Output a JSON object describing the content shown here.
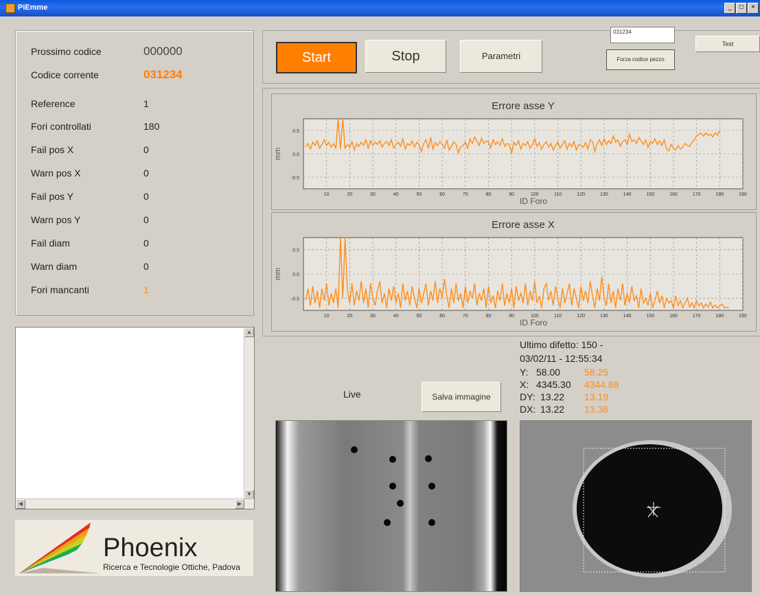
{
  "window": {
    "title": "PiEmme",
    "min": "_",
    "max": "□",
    "close": "×"
  },
  "stats": [
    {
      "label": "Prossimo codice",
      "value": "000000"
    },
    {
      "label": "Codice corrente",
      "value": "031234"
    },
    {
      "label": "Reference",
      "value": "1"
    },
    {
      "label": "Fori controllati",
      "value": "180"
    },
    {
      "label": "Fail pos X",
      "value": "0"
    },
    {
      "label": "Warn pos X",
      "value": "0"
    },
    {
      "label": "Fail pos Y",
      "value": "0"
    },
    {
      "label": "Warn pos Y",
      "value": "0"
    },
    {
      "label": "Fail diam",
      "value": "0"
    },
    {
      "label": "Warn diam",
      "value": "0"
    },
    {
      "label": "Fori mancanti",
      "value": "1"
    }
  ],
  "toolbar": {
    "start_label": "Start",
    "stop_label": "Stop",
    "param_label": "Parametri",
    "code_value": "031234",
    "forza_label": "Forza codice pezzo",
    "test_label": "Test"
  },
  "logo": {
    "name": "Phoenix",
    "subtitle": "Ricerca e Tecnologie Ottiche, Padova"
  },
  "live": {
    "label": "Live",
    "save_label": "Salva immagine"
  },
  "defect": {
    "line1": "Ultimo difetto:   150 -",
    "line2": "03/02/11 - 12:55:34",
    "rows": [
      {
        "key": "Y:",
        "measured": "58.00",
        "nominal": "58.25"
      },
      {
        "key": "X:",
        "measured": "4345.30",
        "nominal": "4344.68"
      },
      {
        "key": "DY:",
        "measured": "13.22",
        "nominal": "13.19"
      },
      {
        "key": "DX:",
        "measured": "13.22",
        "nominal": "13.36"
      }
    ]
  },
  "chart_data": [
    {
      "type": "line",
      "title": "Errore asse Y",
      "xlabel": "ID Foro",
      "ylabel": "mm",
      "xlim": [
        0,
        190
      ],
      "ylim": [
        -0.75,
        0.75
      ],
      "xticks": [
        10,
        20,
        30,
        40,
        50,
        60,
        70,
        80,
        90,
        100,
        110,
        120,
        130,
        140,
        150,
        160,
        170,
        180,
        190
      ],
      "yticks": [
        "0.5",
        "0.0",
        "-0.5"
      ],
      "grid": true,
      "color": "#ff8c1a",
      "series": [
        {
          "x_start": 1,
          "values": [
            0.15,
            0.22,
            0.1,
            0.25,
            0.18,
            0.28,
            0.12,
            0.2,
            0.3,
            0.18,
            0.25,
            0.14,
            0.22,
            0.12,
            0.75,
            0.1,
            0.75,
            0.12,
            0.2,
            0.14,
            0.26,
            0.08,
            0.22,
            0.16,
            0.25,
            0.18,
            0.3,
            0.12,
            0.28,
            0.18,
            0.25,
            0.2,
            0.28,
            0.14,
            0.22,
            0.26,
            0.18,
            0.3,
            0.12,
            0.2,
            0.25,
            0.16,
            0.32,
            0.1,
            0.22,
            0.18,
            0.28,
            0.14,
            0.25,
            0.2,
            0.05,
            0.22,
            0.3,
            0.12,
            0.35,
            0.1,
            0.24,
            0.18,
            0.26,
            0.2,
            0.12,
            0.3,
            0.08,
            0.16,
            0.26,
            0.2,
            0.02,
            0.15,
            0.18,
            0.25,
            0.12,
            0.32,
            0.22,
            0.36,
            0.28,
            0.18,
            0.33,
            0.22,
            0.28,
            0.25,
            0.12,
            0.3,
            0.2,
            0.26,
            0.18,
            0.32,
            0.16,
            0.22,
            0.2,
            0.0,
            0.25,
            0.18,
            0.28,
            0.1,
            0.22,
            0.18,
            0.26,
            0.12,
            0.2,
            0.32,
            0.16,
            0.24,
            0.1,
            0.2,
            0.26,
            0.14,
            0.22,
            0.08,
            0.18,
            0.25,
            0.12,
            0.2,
            0.28,
            0.1,
            0.22,
            0.15,
            0.26,
            0.08,
            0.2,
            0.18,
            0.14,
            0.24,
            0.1,
            0.3,
            0.26,
            0.05,
            0.22,
            0.3,
            0.18,
            0.32,
            0.2,
            0.28,
            0.22,
            0.38,
            0.25,
            0.3,
            0.16,
            0.26,
            0.3,
            0.2,
            0.42,
            0.26,
            0.3,
            0.22,
            0.35,
            0.28,
            0.2,
            0.3,
            0.14,
            0.26,
            0.22,
            0.32,
            0.2,
            0.28,
            0.18,
            0.3,
            0.1,
            0.06,
            0.2,
            0.12,
            0.08,
            0.18,
            0.1,
            0.14,
            0.22,
            0.18,
            0.16,
            0.25,
            0.3,
            0.38,
            0.42,
            0.44,
            0.38,
            0.45,
            0.4,
            0.42,
            0.36,
            0.45,
            0.4,
            0.5
          ]
        }
      ]
    },
    {
      "type": "line",
      "title": "Errore asse X",
      "xlabel": "ID Foro",
      "ylabel": "mm",
      "xlim": [
        0,
        190
      ],
      "ylim": [
        -0.75,
        0.75
      ],
      "xticks": [
        10,
        20,
        30,
        40,
        50,
        60,
        70,
        80,
        90,
        100,
        110,
        120,
        130,
        140,
        150,
        160,
        170,
        180,
        190
      ],
      "yticks": [
        "0.5",
        "0.0",
        "-0.5"
      ],
      "grid": true,
      "color": "#ff8c1a",
      "series": [
        {
          "x_start": 1,
          "values": [
            -0.55,
            -0.3,
            -0.65,
            -0.25,
            -0.6,
            -0.35,
            -0.7,
            -0.3,
            -0.55,
            -0.2,
            -0.65,
            -0.4,
            -0.6,
            -0.3,
            -0.7,
            0.75,
            -0.5,
            0.75,
            -0.35,
            -0.6,
            -0.2,
            -0.65,
            -0.35,
            -0.55,
            -0.15,
            -0.6,
            -0.3,
            -0.7,
            -0.2,
            -0.5,
            -0.65,
            -0.35,
            -0.15,
            -0.6,
            -0.4,
            -0.7,
            -0.3,
            -0.55,
            -0.25,
            -0.6,
            -0.4,
            -0.7,
            -0.2,
            -0.55,
            -0.35,
            -0.65,
            -0.25,
            -0.5,
            -0.7,
            -0.3,
            -0.6,
            -0.4,
            -0.2,
            -0.65,
            -0.35,
            -0.55,
            -0.15,
            -0.6,
            -0.3,
            -0.5,
            -0.1,
            -0.45,
            -0.7,
            -0.3,
            -0.6,
            -0.2,
            -0.55,
            -0.4,
            -0.7,
            -0.25,
            -0.6,
            -0.35,
            -0.5,
            -0.2,
            -0.65,
            -0.4,
            -0.55,
            -0.3,
            -0.7,
            -0.25,
            -0.6,
            -0.45,
            -0.7,
            -0.35,
            -0.55,
            -0.2,
            -0.65,
            -0.4,
            -0.6,
            -0.3,
            -0.7,
            -0.25,
            -0.55,
            -0.4,
            -0.6,
            -0.2,
            -0.65,
            -0.35,
            -0.55,
            -0.15,
            -0.6,
            -0.45,
            -0.7,
            -0.3,
            -0.2,
            -0.55,
            -0.35,
            -0.65,
            -0.25,
            -0.5,
            -0.7,
            -0.3,
            -0.6,
            -0.4,
            -0.2,
            -0.65,
            -0.3,
            -0.5,
            -0.7,
            -0.25,
            -0.55,
            -0.35,
            -0.6,
            -0.15,
            -0.45,
            -0.7,
            -0.3,
            -0.55,
            -0.05,
            -0.5,
            -0.65,
            -0.2,
            -0.6,
            -0.35,
            -0.7,
            -0.3,
            -0.55,
            -0.2,
            -0.65,
            -0.4,
            -0.6,
            -0.25,
            -0.55,
            -0.45,
            -0.7,
            -0.3,
            -0.6,
            -0.5,
            -0.65,
            -0.4,
            -0.7,
            -0.55,
            -0.35,
            -0.6,
            -0.45,
            -0.7,
            -0.5,
            -0.6,
            -0.55,
            -0.7,
            -0.45,
            -0.65,
            -0.55,
            -0.7,
            -0.6,
            -0.5,
            -0.68,
            -0.6,
            -0.7,
            -0.55,
            -0.66,
            -0.6,
            -0.7,
            -0.62,
            -0.68,
            -0.58,
            -0.7,
            -0.64,
            -0.7,
            -0.66,
            -0.62,
            -0.7,
            -0.68,
            -0.7
          ]
        }
      ]
    }
  ]
}
